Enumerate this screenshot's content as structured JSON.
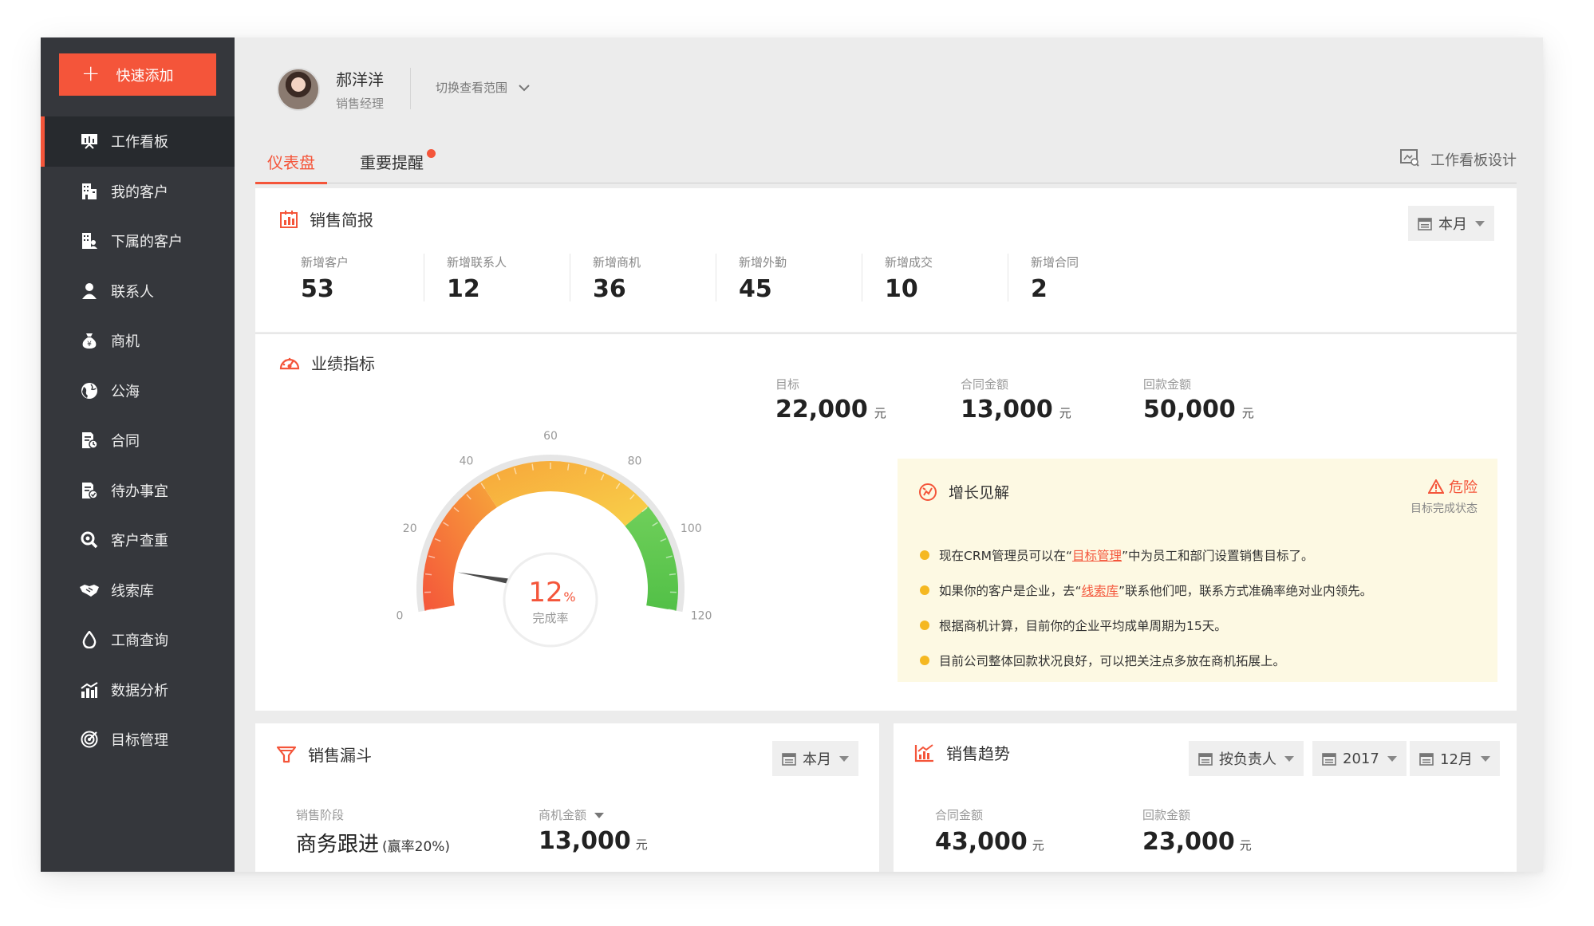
{
  "sidebar": {
    "quick_add": "快速添加",
    "items": [
      {
        "label": "工作看板",
        "icon": "board-icon"
      },
      {
        "label": "我的客户",
        "icon": "customer-building-icon"
      },
      {
        "label": "下属的客户",
        "icon": "subordinate-customer-icon"
      },
      {
        "label": "联系人",
        "icon": "contact-person-icon"
      },
      {
        "label": "商机",
        "icon": "money-bag-icon"
      },
      {
        "label": "公海",
        "icon": "globe-icon"
      },
      {
        "label": "合同",
        "icon": "contract-icon"
      },
      {
        "label": "待办事宜",
        "icon": "todo-icon"
      },
      {
        "label": "客户查重",
        "icon": "search-icon"
      },
      {
        "label": "线索库",
        "icon": "handshake-icon"
      },
      {
        "label": "工商查询",
        "icon": "drop-icon"
      },
      {
        "label": "数据分析",
        "icon": "chart-icon"
      },
      {
        "label": "目标管理",
        "icon": "target-icon"
      }
    ]
  },
  "user": {
    "name": "郝洋洋",
    "role": "销售经理",
    "scope_label": "切换查看范围"
  },
  "tabs": {
    "dashboard": "仪表盘",
    "reminder": "重要提醒",
    "board_design": "工作看板设计"
  },
  "brief": {
    "title": "销售简报",
    "period": "本月",
    "stats": [
      {
        "label": "新增客户",
        "value": "53"
      },
      {
        "label": "新增联系人",
        "value": "12"
      },
      {
        "label": "新增商机",
        "value": "36"
      },
      {
        "label": "新增外勤",
        "value": "45"
      },
      {
        "label": "新增成交",
        "value": "10"
      },
      {
        "label": "新增合同",
        "value": "2"
      }
    ]
  },
  "performance": {
    "title": "业绩指标",
    "gauge": {
      "value": 12,
      "value_text": "12",
      "percent_sign": "%",
      "label": "完成率",
      "min": 0,
      "max": 120,
      "ticks": [
        "0",
        "20",
        "40",
        "60",
        "80",
        "100",
        "120"
      ],
      "colors": {
        "low": "#f4553a",
        "mid": "#f8c63d",
        "high": "#5cc44f"
      }
    },
    "kpis": [
      {
        "label": "目标",
        "value": "22,000",
        "unit": "元"
      },
      {
        "label": "合同金额",
        "value": "13,000",
        "unit": "元"
      },
      {
        "label": "回款金额",
        "value": "50,000",
        "unit": "元"
      }
    ],
    "insight": {
      "title": "增长见解",
      "status": "危险",
      "status_sub": "目标完成状态",
      "items": [
        {
          "before": "现在CRM管理员可以在“",
          "link": "目标管理",
          "after": "”中为员工和部门设置销售目标了。"
        },
        {
          "before": "如果你的客户是企业，去“",
          "link": "线索库",
          "after": "”联系他们吧，联系方式准确率绝对业内领先。"
        },
        {
          "before": "根据商机计算，目前你的企业平均成单周期为15天。",
          "link": "",
          "after": ""
        },
        {
          "before": "目前公司整体回款状况良好，可以把关注点多放在商机拓展上。",
          "link": "",
          "after": ""
        }
      ]
    }
  },
  "funnel": {
    "title": "销售漏斗",
    "period": "本月",
    "stage_label": "销售阶段",
    "stage_value": "商务跟进",
    "stage_rate": "(赢率20%)",
    "amount_label": "商机金额",
    "amount_value": "13,000",
    "amount_unit": "元"
  },
  "trend": {
    "title": "销售趋势",
    "filter_owner": "按负责人",
    "filter_year": "2017",
    "filter_month": "12月",
    "contract_label": "合同金额",
    "contract_value": "43,000",
    "payment_label": "回款金额",
    "payment_value": "23,000",
    "unit": "元"
  },
  "accent": "#f4553a"
}
